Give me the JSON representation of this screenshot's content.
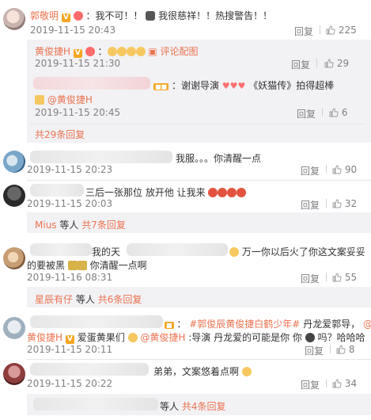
{
  "c1": {
    "name": "郭敬明",
    "text": "：我不可！！",
    "text2": "我很慈祥！！热搜警告！！",
    "time": "2019-11-15 20:43",
    "reply": "回复",
    "likes": "225"
  },
  "c1_reply1": {
    "name": "黄俊捷H",
    "time": "2019-11-15 21:30",
    "pic_label": "评论配图",
    "reply": "回复",
    "likes": "29"
  },
  "c1_reply2": {
    "text": "：谢谢导演",
    "text2": "《妖猫传》拍得超棒",
    "mention": "@黄俊捷H",
    "time": "2019-11-15 20:45",
    "reply": "回复",
    "likes": "6"
  },
  "c1_more": "共29条回复",
  "c2": {
    "text": "我服。。。你清醒一点",
    "time": "2019-11-15 20:23",
    "reply": "回复",
    "likes": "90"
  },
  "c3": {
    "text": "三后一张那位 放开他 让我来",
    "time": "2019-11-15 20:03",
    "reply": "回复",
    "likes": "32"
  },
  "c3_sub": {
    "name": "Mius",
    "text": "等人",
    "more": "共7条回复"
  },
  "c4": {
    "text_a": "我的天",
    "text_b": "万一你以后火了你这文案妥妥",
    "text_c": "的要被黑",
    "text_d": "你清醒一点啊",
    "time": "2019-11-16 08:31",
    "reply": "回复",
    "likes": "55"
  },
  "c4_sub": {
    "name": "星辰有仔",
    "text": "等人",
    "more": "共6条回复"
  },
  "c5": {
    "tag1": "#郭俊辰黄俊捷白鹤少年#",
    "text_a": "丹龙爱郭导，",
    "at": "@",
    "name": "黄俊捷H",
    "text_b": "爱蛋黄果们",
    "mention": "@黄俊捷H",
    "text_c": ":导演 丹龙爱的可能是你 你",
    "text_d": "吗？哈哈哈",
    "time": "2019-11-15 20:11",
    "reply": "回复",
    "likes": "8"
  },
  "c6": {
    "text": "弟弟，文案悠着点啊",
    "time": "2019-11-15 20:22",
    "reply": "回复",
    "likes": "34"
  },
  "c6_sub": {
    "text": "等人",
    "more": "共4条回复"
  },
  "colors": {
    "accent": "#eb7350",
    "time": "#808080",
    "sub_bg": "#f2f2f5"
  }
}
